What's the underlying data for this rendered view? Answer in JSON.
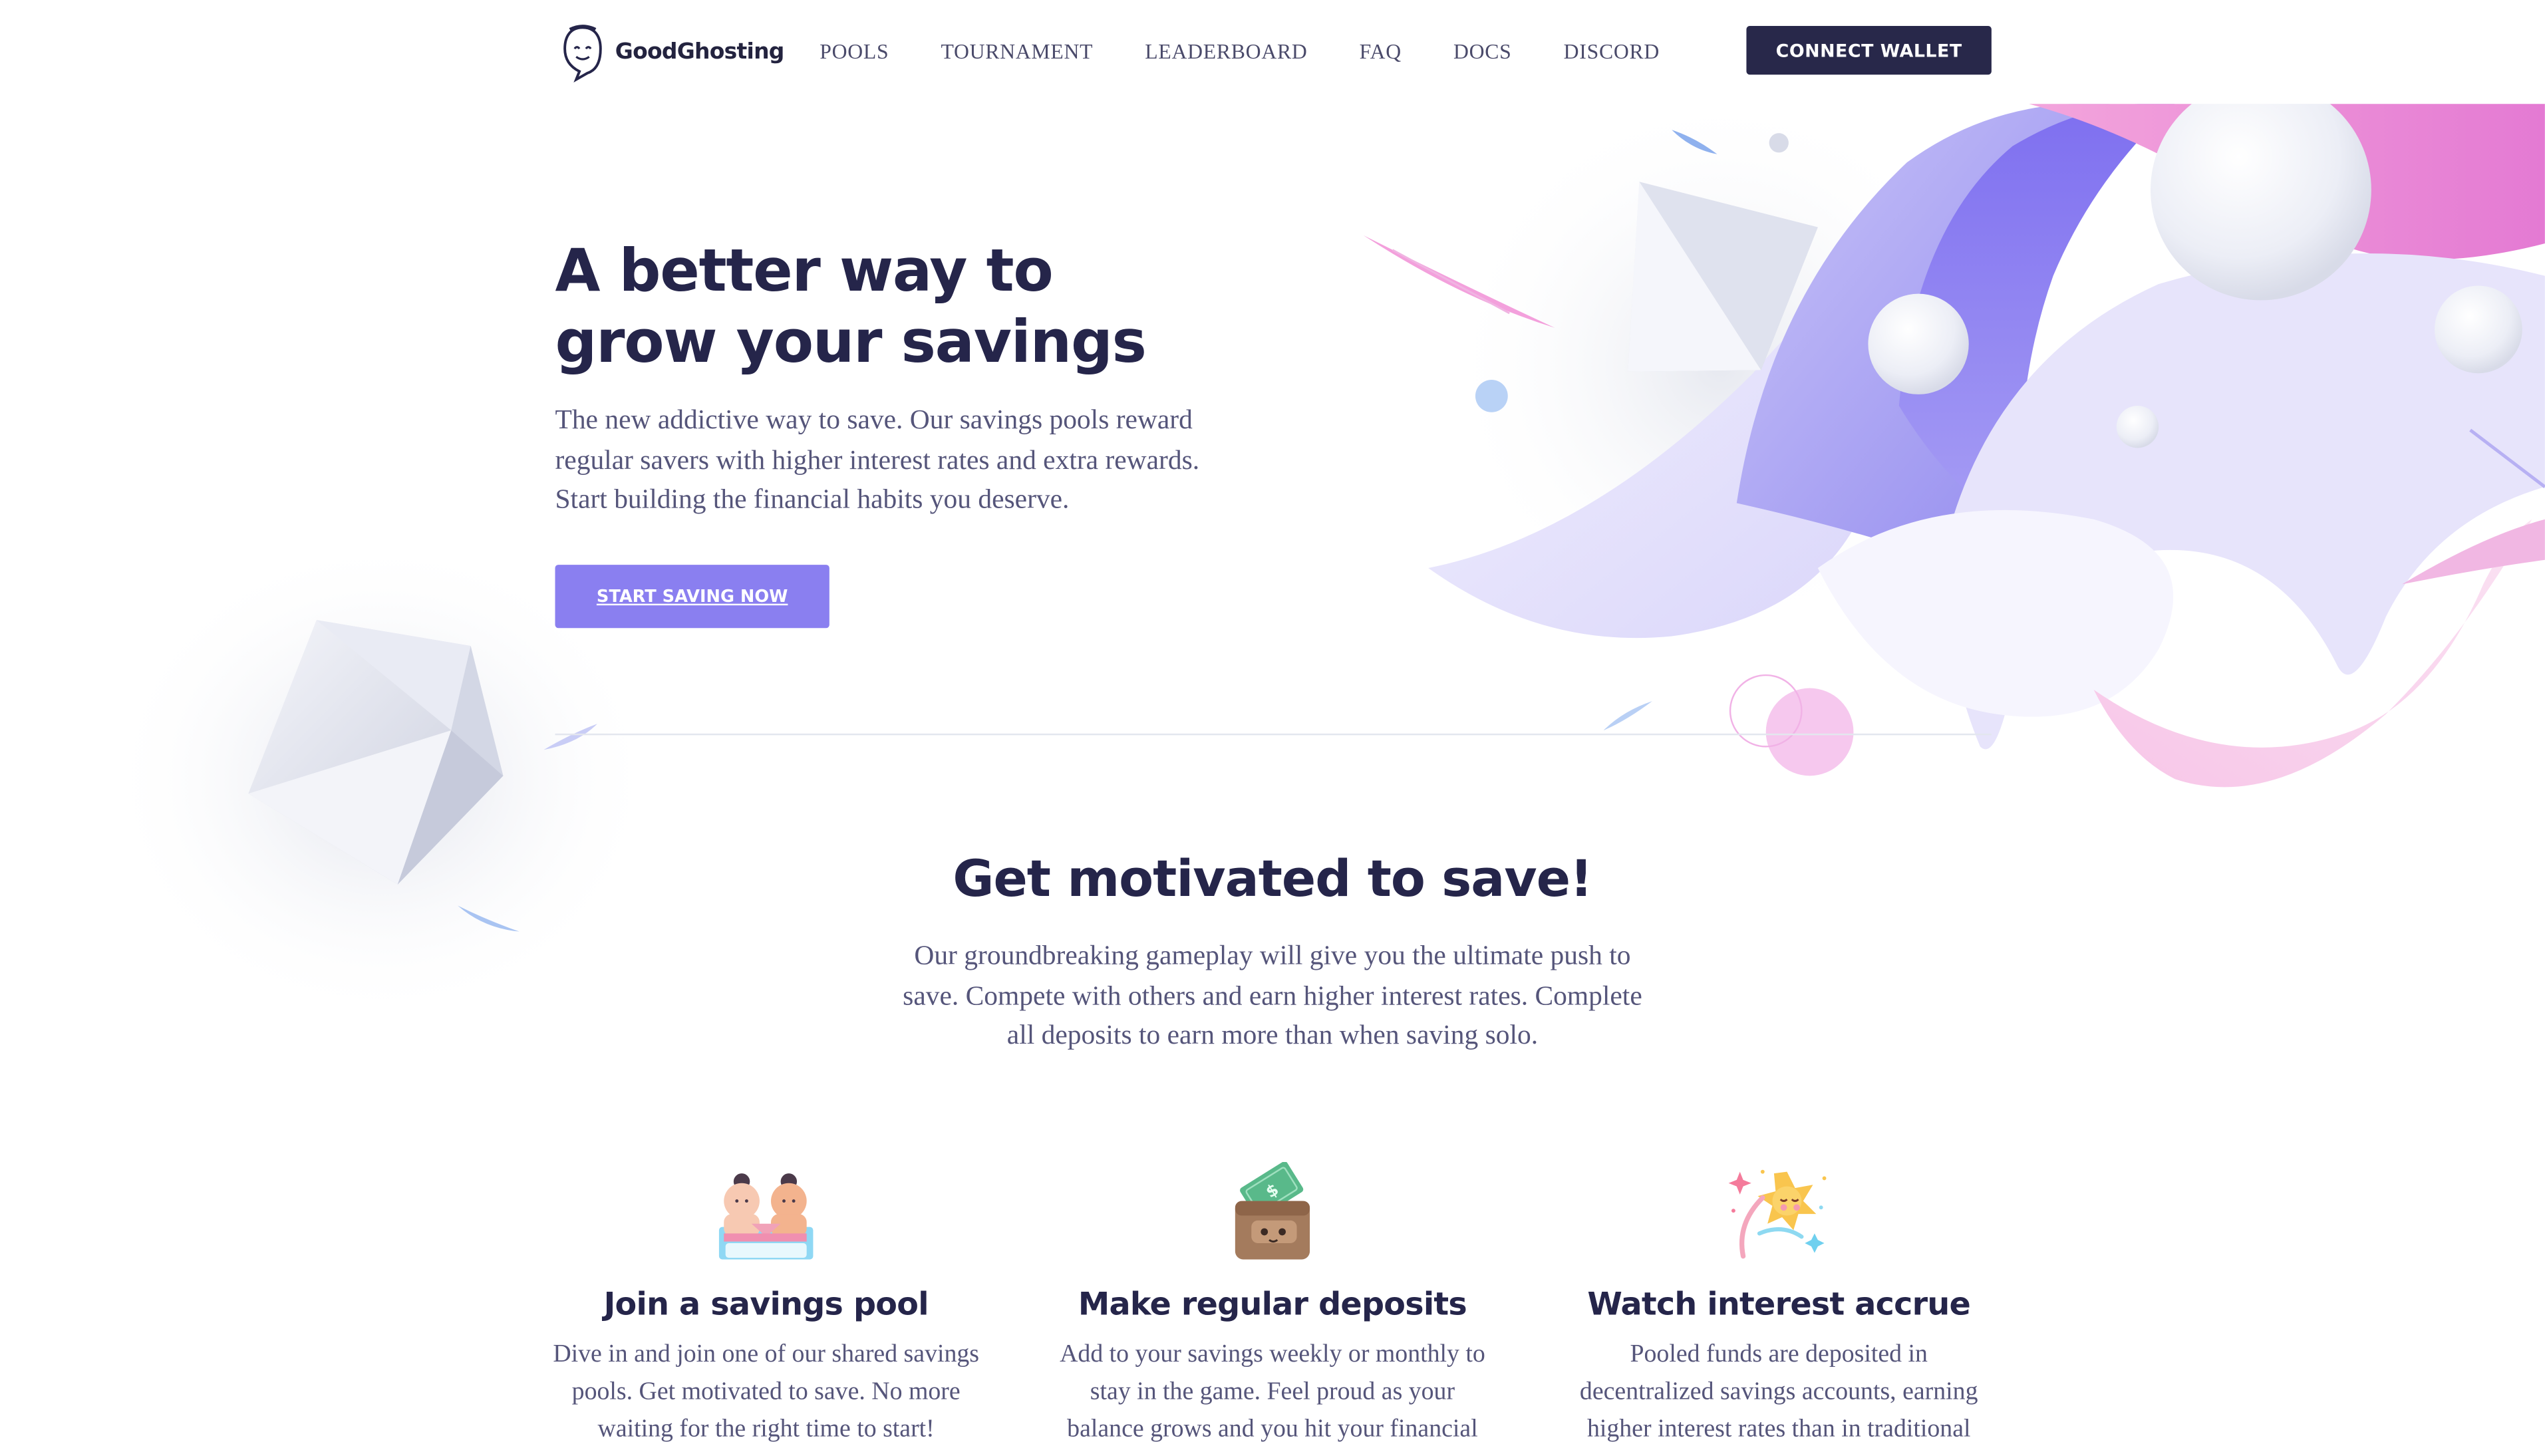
{
  "nav": {
    "logo_text": "GoodGhosting",
    "links": [
      "POOLS",
      "TOURNAMENT",
      "LEADERBOARD",
      "FAQ",
      "DOCS",
      "DISCORD"
    ],
    "connect_label": "CONNECT WALLET"
  },
  "hero": {
    "title_line1": "A better way to",
    "title_line2": "grow your savings",
    "subtitle": "The new addictive way to save. Our savings pools reward regular savers with higher interest rates and extra rewards. Start building the financial habits you deserve.",
    "cta_label": "START SAVING NOW"
  },
  "motivate": {
    "title": "Get motivated to save!",
    "subtitle": "Our groundbreaking gameplay will give you the ultimate push to save. Compete with others and earn higher interest rates. Complete all deposits to earn more than when saving solo."
  },
  "features": [
    {
      "icon": "sumo-wrestlers-icon",
      "title": "Join a savings pool",
      "text": "Dive in and join one of our shared savings pools. Get motivated to save. No more waiting for the right time to start!"
    },
    {
      "icon": "wallet-icon",
      "title": "Make regular deposits",
      "text": "Add to your savings weekly or monthly to stay in the game. Feel proud as your balance grows and you hit your financial"
    },
    {
      "icon": "sparkling-sun-icon",
      "title": "Watch interest accrue",
      "text": "Pooled funds are deposited in decentralized savings accounts, earning higher interest rates than in traditional"
    }
  ],
  "colors": {
    "navy": "#25254a",
    "cta_purple": "#8a7ff0",
    "connect_bg": "#28284a",
    "body_text": "#55557a"
  }
}
